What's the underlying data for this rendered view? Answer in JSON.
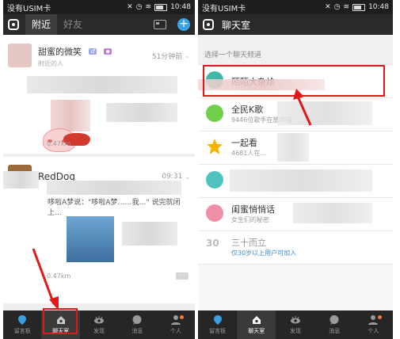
{
  "left": {
    "status": {
      "carrier": "没有USIM卡",
      "time": "10:48"
    },
    "tabs": [
      {
        "label": "附近"
      },
      {
        "label": "好友"
      }
    ],
    "posts": [
      {
        "name": "甜蜜的微笑",
        "time": "51分钟前",
        "sub": "附近的人",
        "distance": "0.47km"
      },
      {
        "name": "RedDog",
        "time": "09:31",
        "text": "哆啦A梦说：\"哆啦A梦……我…\" 说完就闭上…",
        "distance": "0.47km"
      }
    ],
    "nav": [
      {
        "label": "留言板",
        "icon": "location-pin-icon"
      },
      {
        "label": "聊天室",
        "icon": "home-chat-icon"
      },
      {
        "label": "发现",
        "icon": "eye-icon"
      },
      {
        "label": "消息",
        "icon": "chat-bubble-icon"
      },
      {
        "label": "个人",
        "icon": "person-icon"
      }
    ]
  },
  "right": {
    "status": {
      "carrier": "没有USIM卡",
      "time": "10:48"
    },
    "title": "聊天室",
    "section_label": "选择一个聊天频道",
    "rooms": [
      {
        "name": "陌陌大杂烩",
        "sub": ""
      },
      {
        "name": "全民K歌",
        "sub": "9446位歌手在放声唱"
      },
      {
        "name": "一起看",
        "sub": "4681人在…"
      },
      {
        "name": "",
        "sub": ""
      },
      {
        "name": "闺蜜悄悄话",
        "sub": "女生们的秘密"
      },
      {
        "name": "三十而立",
        "sub": "仅30岁以上用户可加入"
      }
    ],
    "nav": [
      {
        "label": "留言板",
        "icon": "location-pin-icon"
      },
      {
        "label": "聊天室",
        "icon": "home-chat-icon"
      },
      {
        "label": "发现",
        "icon": "eye-icon"
      },
      {
        "label": "消息",
        "icon": "chat-bubble-icon"
      },
      {
        "label": "个人",
        "icon": "person-icon"
      }
    ]
  },
  "colors": {
    "accent": "#38a3e8",
    "highlight": "#e01919",
    "bar": "#2a2a2a"
  }
}
